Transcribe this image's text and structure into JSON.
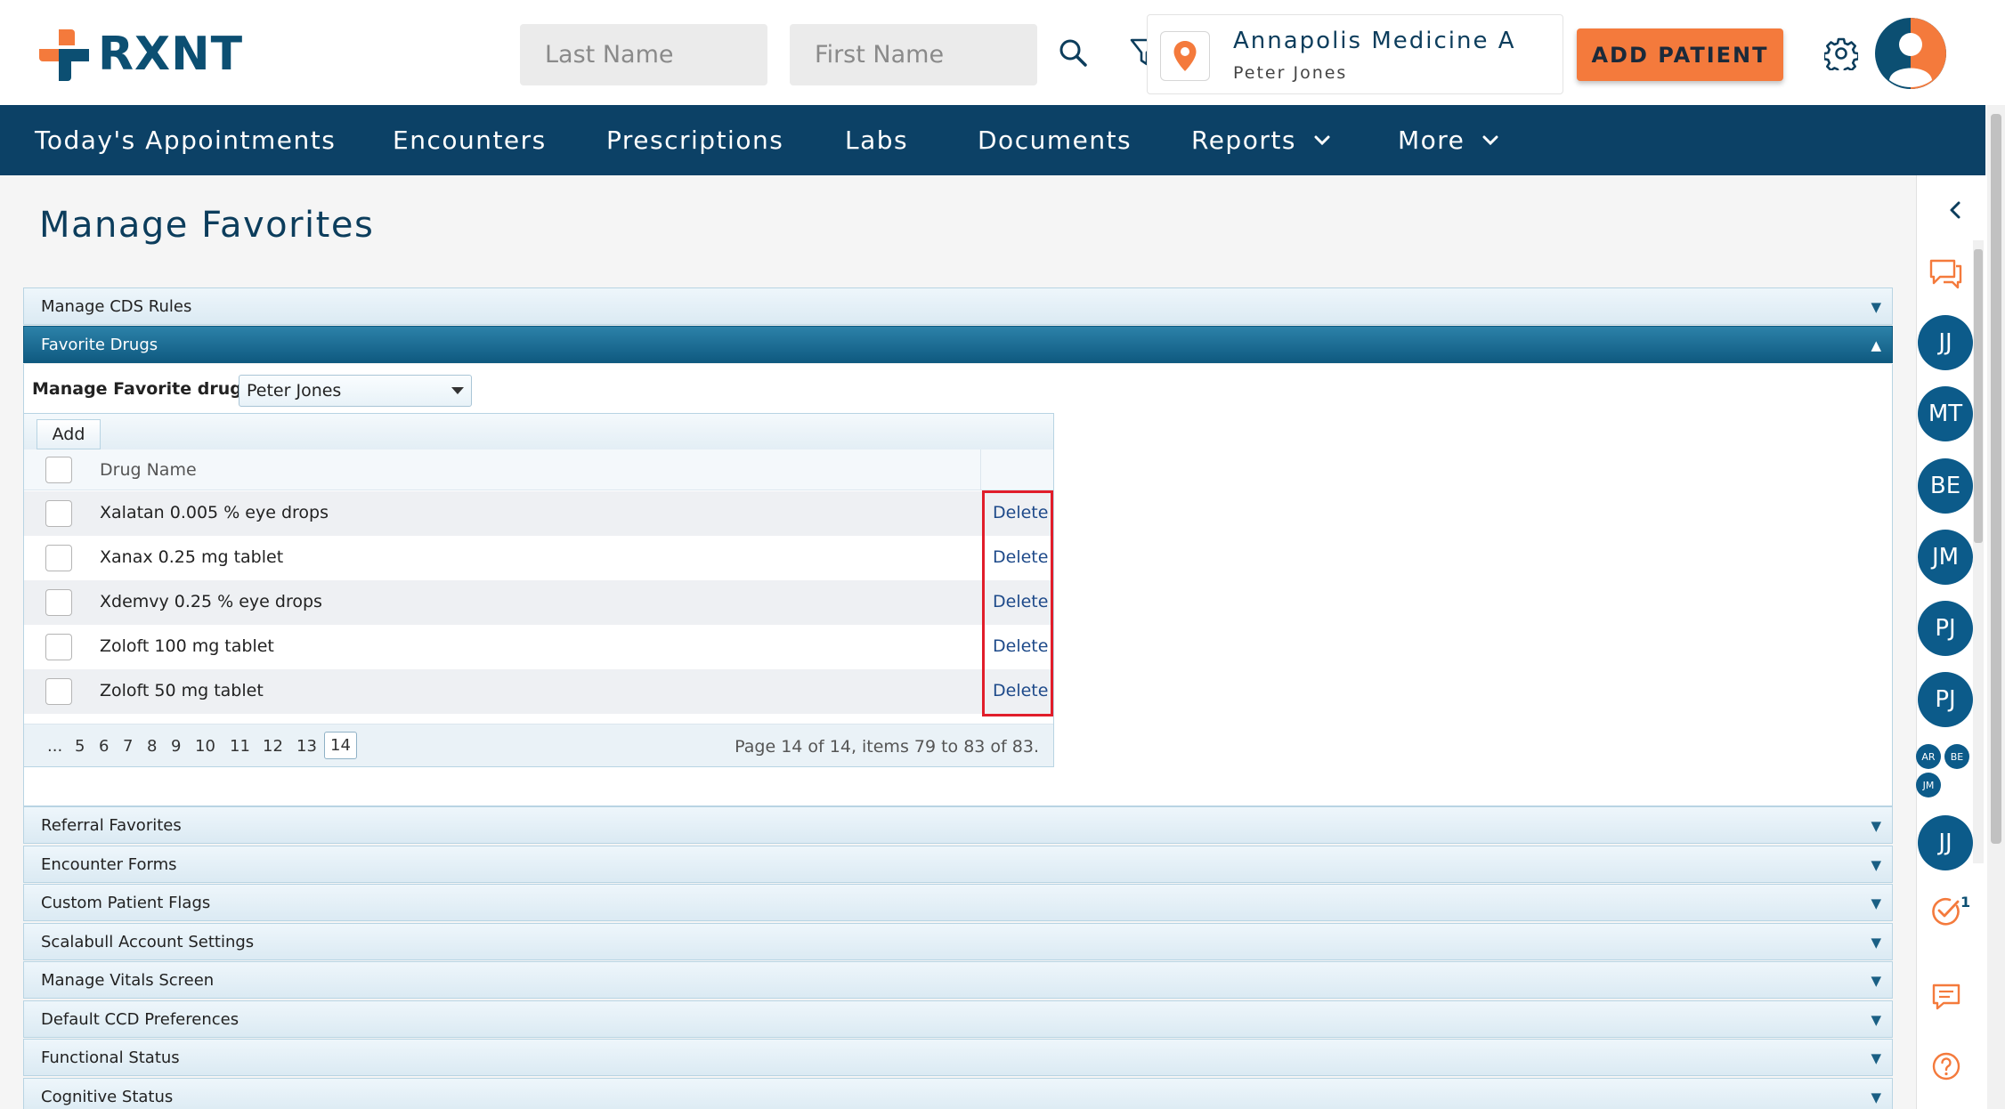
{
  "header": {
    "logo_text": "RXNT",
    "last_name_placeholder": "Last Name",
    "first_name_placeholder": "First Name",
    "location": {
      "title": "Annapolis Medicine A",
      "subtitle": "Peter Jones"
    },
    "add_patient_label": "ADD PATIENT"
  },
  "nav": {
    "items": [
      {
        "label": "Today's Appointments"
      },
      {
        "label": "Encounters"
      },
      {
        "label": "Prescriptions"
      },
      {
        "label": "Labs"
      },
      {
        "label": "Documents"
      },
      {
        "label": "Reports"
      },
      {
        "label": "More"
      }
    ]
  },
  "page": {
    "title": "Manage Favorites"
  },
  "panels": {
    "cds": "Manage CDS Rules",
    "favorite_drugs": "Favorite Drugs",
    "referral": "Referral Favorites",
    "encounter_forms": "Encounter Forms",
    "custom_flags": "Custom Patient Flags",
    "scalabull": "Scalabull Account Settings",
    "vitals": "Manage Vitals Screen",
    "ccd": "Default CCD Preferences",
    "functional": "Functional Status",
    "cognitive": "Cognitive Status"
  },
  "favorites": {
    "for_label": "Manage Favorite drugs for",
    "selected_provider": "Peter Jones",
    "add_label": "Add",
    "column_drug_name": "Drug Name",
    "delete_label": "Delete",
    "rows": [
      {
        "name": "Xalatan 0.005 % eye drops"
      },
      {
        "name": "Xanax 0.25 mg tablet"
      },
      {
        "name": "Xdemvy 0.25 % eye drops"
      },
      {
        "name": "Zoloft 100 mg tablet"
      },
      {
        "name": "Zoloft 50 mg tablet"
      }
    ],
    "pager": {
      "ellipsis": "...",
      "pages": [
        "5",
        "6",
        "7",
        "8",
        "9",
        "10",
        "11",
        "12",
        "13"
      ],
      "current": "14",
      "info": "Page 14 of 14, items 79 to 83 of 83."
    }
  },
  "rail": {
    "avatars": [
      "JJ",
      "MT",
      "BE",
      "JM",
      "PJ",
      "PJ"
    ],
    "small_avatars": [
      "AR",
      "BE",
      "JM"
    ],
    "last_avatar": "JJ",
    "task_badge": "1"
  },
  "colors": {
    "brand_navy": "#0c4166",
    "accent_orange": "#f47a3c",
    "highlight_red": "#e11d2a"
  }
}
